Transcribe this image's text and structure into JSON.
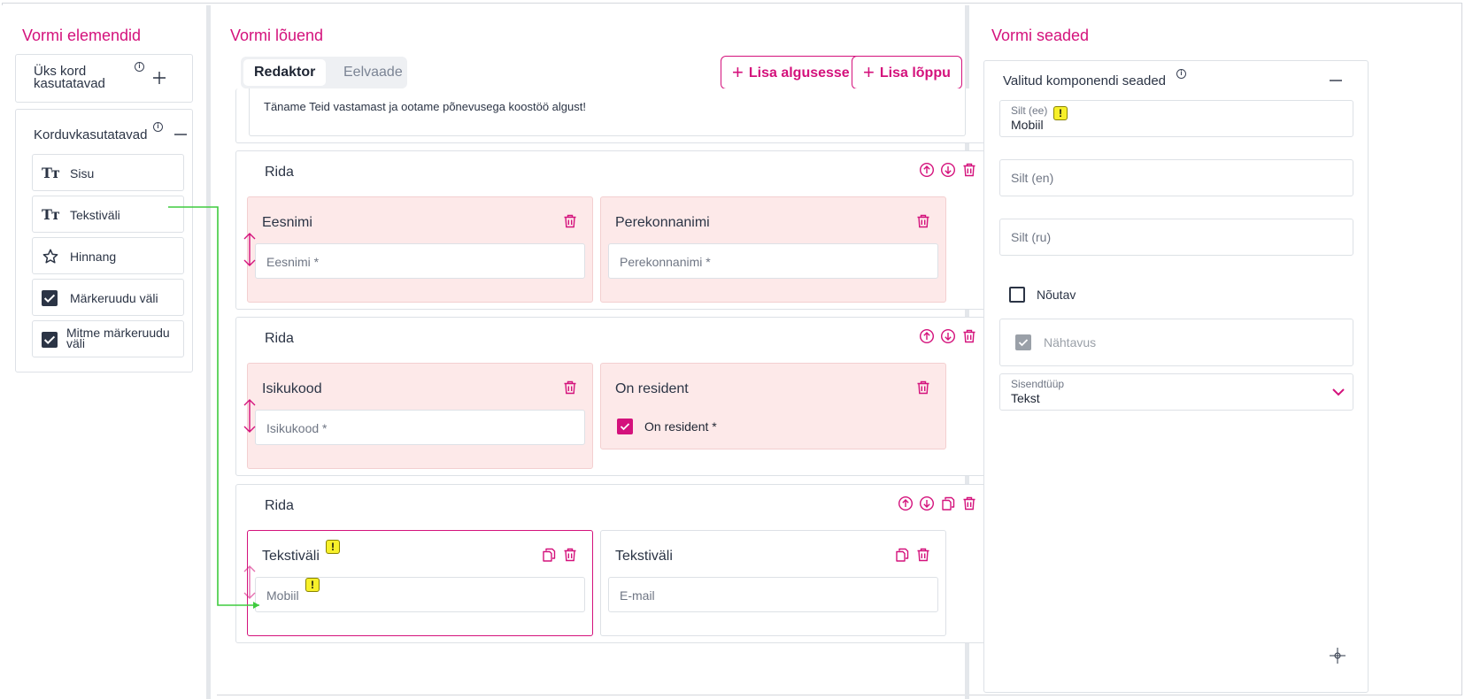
{
  "left_panel": {
    "title": "Vormi elemendid",
    "once": {
      "label": "Üks kord kasutatavad",
      "label_line1": "Üks kord",
      "label_line2": "kasutatavad"
    },
    "reusable": {
      "label": "Korduvkasutatavad",
      "items": [
        {
          "label": "Sisu",
          "icon": "text-format-icon"
        },
        {
          "label": "Tekstiväli",
          "icon": "text-format-icon"
        },
        {
          "label": "Hinnang",
          "icon": "star-icon"
        },
        {
          "label": "Märkeruudu väli",
          "icon": "checkbox-icon"
        },
        {
          "label": "Mitme märkeruudu väli",
          "label_line1": "Mitme märkeruudu",
          "label_line2": "väli",
          "icon": "checkbox-icon"
        }
      ]
    }
  },
  "canvas": {
    "title": "Vormi lõuend",
    "tabs": [
      {
        "label": "Redaktor",
        "active": true
      },
      {
        "label": "Eelvaade",
        "active": false
      }
    ],
    "buttons": {
      "add_start": "Lisa algusesse",
      "add_end": "Lisa lõppu"
    },
    "content_text": "Täname Teid vastamast ja ootame põnevusega koostöö algust!",
    "rows": [
      {
        "title": "Rida",
        "fields": [
          {
            "title": "Eesnimi",
            "placeholder": "Eesnimi *"
          },
          {
            "title": "Perekonnanimi",
            "placeholder": "Perekonnanimi *"
          }
        ]
      },
      {
        "title": "Rida",
        "fields": [
          {
            "title": "Isikukood",
            "placeholder": "Isikukood *"
          },
          {
            "title": "On resident",
            "checkbox_label": "On resident *"
          }
        ]
      },
      {
        "title": "Rida",
        "fields": [
          {
            "title": "Tekstiväli",
            "placeholder": "Mobiil"
          },
          {
            "title": "Tekstiväli",
            "placeholder": "E-mail"
          }
        ]
      }
    ]
  },
  "settings": {
    "title": "Vormi seaded",
    "card_title": "Valitud komponendi seaded",
    "label_ee": {
      "label": "Silt (ee)",
      "value": "Mobiil"
    },
    "label_en": {
      "placeholder": "Silt (en)"
    },
    "label_ru": {
      "placeholder": "Silt (ru)"
    },
    "required": {
      "label": "Nõutav",
      "checked": false
    },
    "visibility": {
      "label": "Nähtavus",
      "checked": true
    },
    "input_type": {
      "label": "Sisendtüüp",
      "value": "Tekst"
    }
  },
  "warning_glyph": "!",
  "colors": {
    "accent": "#d4127c",
    "field_bg": "#fde9e9",
    "warning": "#f7f02a",
    "connector": "#3ecb3e"
  }
}
